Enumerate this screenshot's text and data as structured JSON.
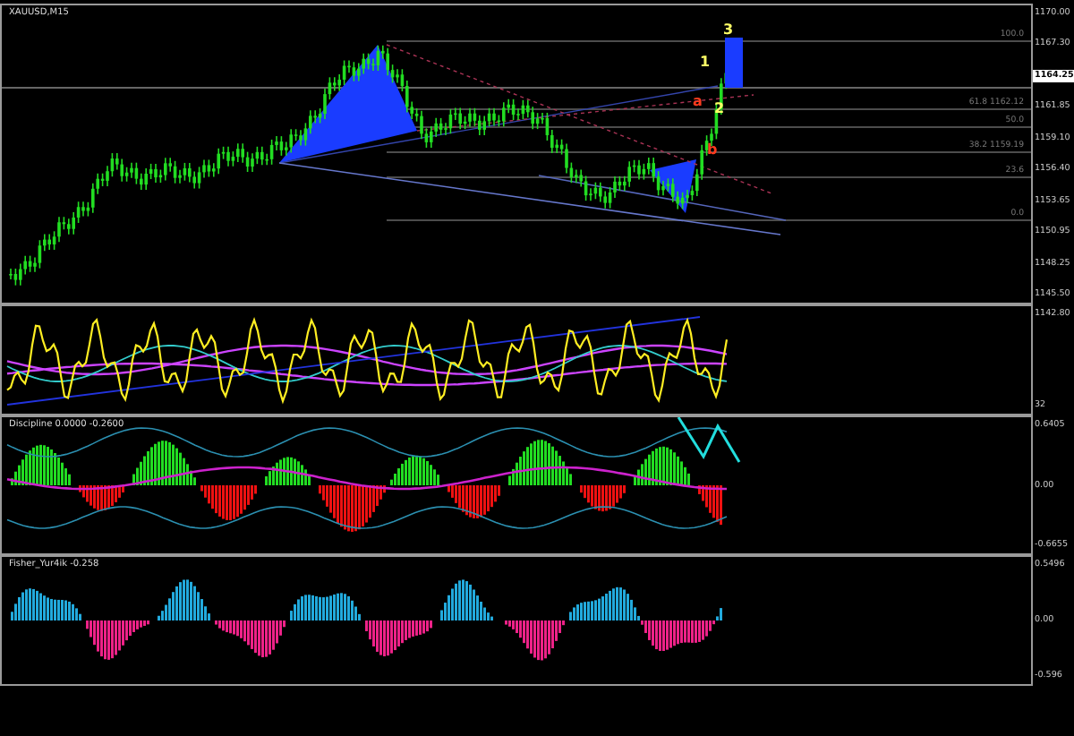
{
  "main_chart": {
    "symbol": "XAUUSD,M15",
    "price_axis": [
      {
        "text": "1170.00",
        "highlighted": false
      },
      {
        "text": "1167.30",
        "highlighted": false
      },
      {
        "text": "1164.25",
        "highlighted": true
      },
      {
        "text": "1161.85",
        "highlighted": false
      },
      {
        "text": "1159.10",
        "highlighted": false
      },
      {
        "text": "1156.40",
        "highlighted": false
      },
      {
        "text": "1153.65",
        "highlighted": false
      },
      {
        "text": "1150.95",
        "highlighted": false
      },
      {
        "text": "1148.25",
        "highlighted": false
      },
      {
        "text": "1145.50",
        "highlighted": false
      }
    ],
    "fib_levels": [
      {
        "label": "100.0"
      },
      {
        "label": "61.8 1162.12"
      },
      {
        "label": "50.0"
      },
      {
        "label": "38.2 1159.19"
      },
      {
        "label": "23.6"
      },
      {
        "label": "0.0"
      }
    ],
    "wave_labels": [
      {
        "text": "1",
        "kind": "impulse"
      },
      {
        "text": "2",
        "kind": "impulse"
      },
      {
        "text": "3",
        "kind": "impulse"
      },
      {
        "text": "a",
        "kind": "corrective"
      },
      {
        "text": "b",
        "kind": "corrective"
      }
    ]
  },
  "oscillator": {
    "axis": [
      "1142.80",
      "32"
    ]
  },
  "discipline": {
    "title": "Discipline 0.0000 -0.2600",
    "axis": [
      "0.6405",
      "0.00",
      "-0.6655"
    ]
  },
  "fisher": {
    "title": "Fisher_Yur4ik -0.258",
    "axis": [
      "0.5496",
      "0.00",
      "-0.596"
    ]
  }
}
